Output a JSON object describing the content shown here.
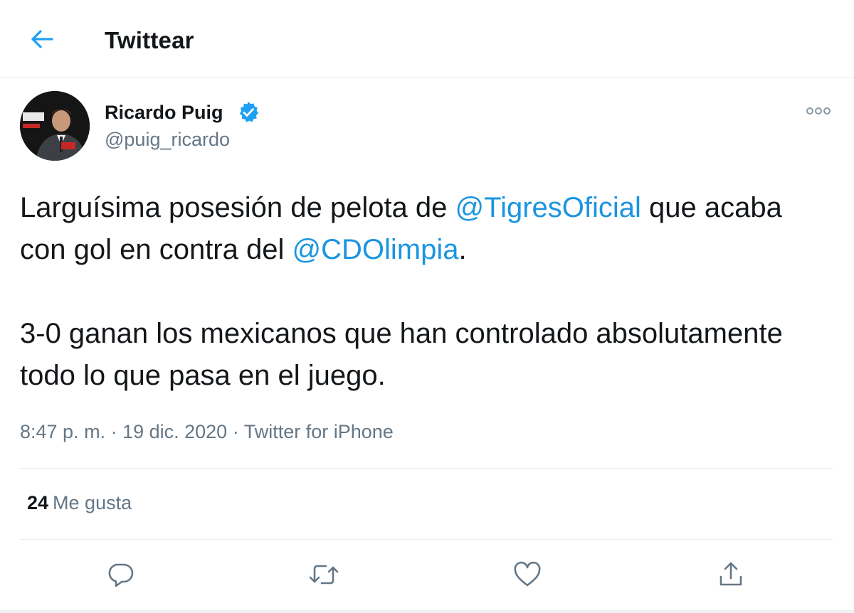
{
  "header": {
    "title": "Twittear"
  },
  "author": {
    "name": "Ricardo Puig",
    "handle": "@puig_ricardo",
    "verified": true
  },
  "tweet": {
    "para1": {
      "t1": "Larguísima posesión de pelota de ",
      "m1": "@TigresOficial",
      "t2": " que acaba con gol en contra del ",
      "m2": "@CDOlimpia",
      "t3": "."
    },
    "para2": "3-0 ganan los mexicanos que han controlado absolutamente todo lo que pasa en el juego.",
    "time": "8:47 p. m.",
    "sep1": " · ",
    "date": "19 dic. 2020",
    "sep2": " · ",
    "source": "Twitter for iPhone"
  },
  "stats": {
    "likes_count": "24",
    "likes_label": "Me gusta"
  },
  "icons": {
    "back": "arrow-left-icon",
    "verified": "verified-badge-icon",
    "more": "more-dots-icon",
    "reply": "reply-icon",
    "retweet": "retweet-icon",
    "like": "heart-icon",
    "share": "share-icon"
  },
  "colors": {
    "accent": "#1da1f2",
    "mention": "#1b95e0",
    "secondary_text": "#657786"
  }
}
